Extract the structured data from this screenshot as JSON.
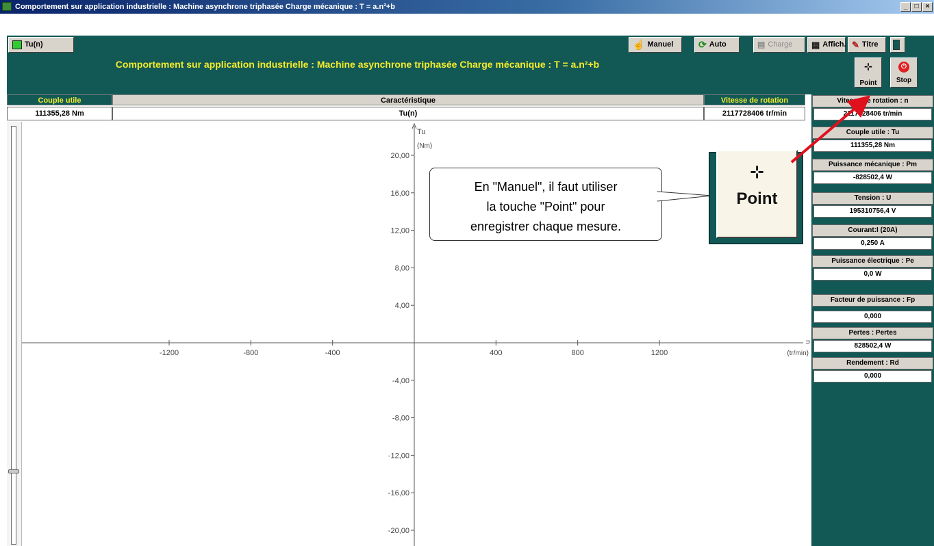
{
  "window": {
    "title": "Comportement sur application industrielle : Machine asynchrone triphasée Charge mécanique : T = a.n²+b",
    "controls": [
      "_",
      "□",
      "×"
    ]
  },
  "toolbar": {
    "curve_tab": "Tu(n)",
    "manuel": "Manuel",
    "auto": "Auto",
    "charge": "Charge",
    "affich": "Affich.",
    "titre": "Titre"
  },
  "header": {
    "title": "Comportement sur application industrielle :  Machine asynchrone triphasée Charge mécanique : T = a.n²+b",
    "point_label": "Point",
    "stop_label": "Stop"
  },
  "readouts": {
    "couple_header": "Couple utile",
    "couple_value": "111355,28 Nm",
    "carac_header": "Caractéristique",
    "carac_value": "Tu(n)",
    "vitesse_header": "Vitesse de rotation",
    "vitesse_value": "2117728406 tr/min"
  },
  "panel": {
    "items": [
      {
        "label": "Vitesse de rotation : n",
        "value": "2117728406 tr/min"
      },
      {
        "label": "Couple utile : Tu",
        "value": "111355,28 Nm"
      },
      {
        "label": "Puissance mécanique : Pm",
        "value": "-828502,4 W"
      },
      {
        "label": "Tension : U",
        "value": "195310756,4 V"
      },
      {
        "label": "Courant:I (20A)",
        "value": "0,250 A"
      },
      {
        "label": "Puissance électrique : Pe",
        "value": "0,0 W"
      },
      {
        "label": "Facteur de puissance : Fp",
        "value": "0,000"
      },
      {
        "label": "Pertes : Pertes",
        "value": "828502,4 W"
      },
      {
        "label": "Rendement : Rd",
        "value": "0,000"
      }
    ]
  },
  "callout": {
    "line1": "En \"Manuel\", il faut utiliser",
    "line2": "la touche \"Point\" pour",
    "line3": "enregistrer chaque mesure."
  },
  "zoom": {
    "label": "Point"
  },
  "chart_data": {
    "type": "scatter",
    "x_ticks": [
      "-1200",
      "-800",
      "-400",
      "400",
      "800",
      "1200"
    ],
    "y_ticks": [
      "20,00",
      "16,00",
      "12,00",
      "8,00",
      "4,00",
      "-4,00",
      "-8,00",
      "-12,00",
      "-16,00",
      "-20,00"
    ],
    "xlim": [
      -1200,
      1200
    ],
    "ylim": [
      -20,
      20
    ],
    "y_axis_name": "Tu",
    "y_axis_unit": "(Nm)",
    "x_axis_name": "n",
    "x_axis_unit": "(tr/min)",
    "series": []
  },
  "colors": {
    "panel_green": "#125956",
    "title_yellow": "#f4ec2c",
    "arrow_red": "#e0101c"
  }
}
